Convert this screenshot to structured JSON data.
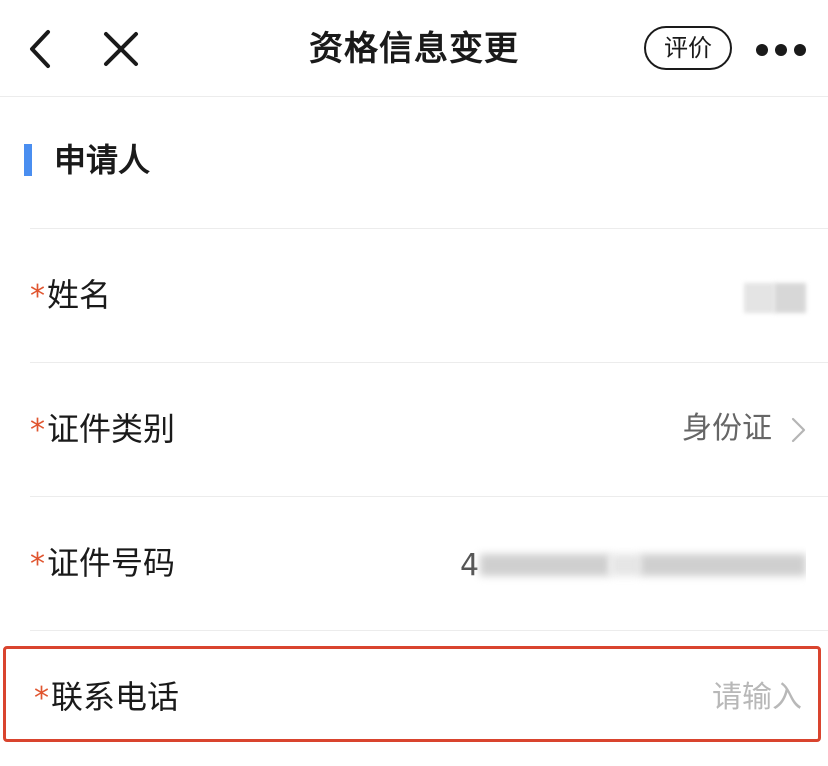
{
  "header": {
    "title": "资格信息变更",
    "rate_label": "评价"
  },
  "section": {
    "title": "申请人"
  },
  "required_mark": "*",
  "fields": {
    "name": {
      "label": "姓名"
    },
    "id_type": {
      "label": "证件类别",
      "value": "身份证"
    },
    "id_number": {
      "label": "证件号码",
      "value_visible_prefix": "4"
    },
    "phone": {
      "label": "联系电话",
      "placeholder": "请输入"
    }
  },
  "colors": {
    "accent": "#4a8ef0",
    "required": "#e0552f",
    "highlight_border": "#d9442e"
  },
  "icons": [
    "back-arrow-icon",
    "close-icon",
    "more-icon",
    "chevron-right-icon"
  ]
}
